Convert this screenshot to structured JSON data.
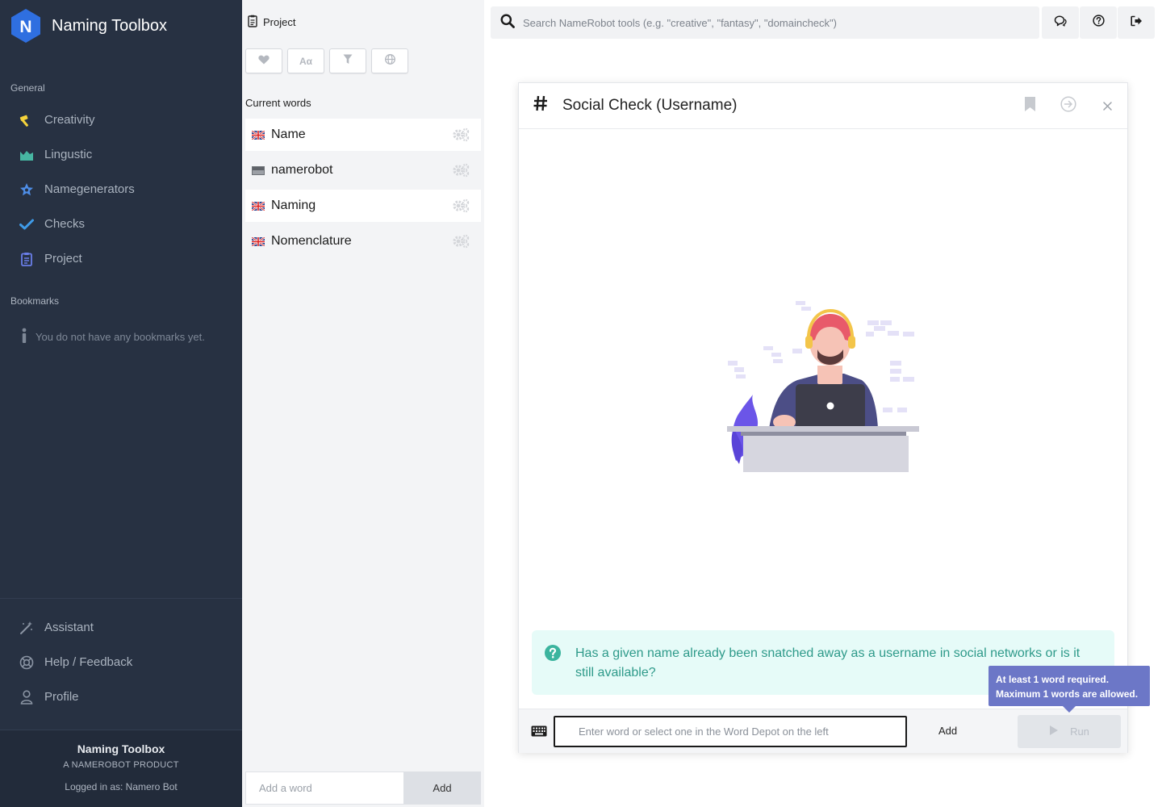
{
  "brand": {
    "title": "Naming Toolbox",
    "logo_letter": "N"
  },
  "sidebar": {
    "general_label": "General",
    "items": [
      {
        "label": "Creativity",
        "icon": "hammer-icon",
        "color": "#f5d33b"
      },
      {
        "label": "Lingustic",
        "icon": "chart-area-icon",
        "color": "#47b6a2"
      },
      {
        "label": "Namegenerators",
        "icon": "star-gear-icon",
        "color": "#4e8ee8"
      },
      {
        "label": "Checks",
        "icon": "check-icon",
        "color": "#3f9be8"
      },
      {
        "label": "Project",
        "icon": "clipboard-icon",
        "color": "#6a7ee8"
      }
    ],
    "bookmarks_label": "Bookmarks",
    "no_bookmarks_text": "You do not have any bookmarks yet.",
    "bottom_items": [
      {
        "label": "Assistant",
        "icon": "magic-wand-icon"
      },
      {
        "label": "Help / Feedback",
        "icon": "lifebuoy-icon"
      },
      {
        "label": "Profile",
        "icon": "user-icon"
      }
    ],
    "footer": {
      "title": "Naming Toolbox",
      "subtitle": "A NAMEROBOT PRODUCT",
      "logged_in": "Logged in as: Namero Bot"
    }
  },
  "depot": {
    "title": "Project",
    "filters": [
      "heart-icon",
      "font-case-icon",
      "filter-icon",
      "globe-icon"
    ],
    "filter_case_label": "Aα",
    "current_words_label": "Current words",
    "words": [
      {
        "text": "Name",
        "flag": "uk-flag",
        "highlighted": true
      },
      {
        "text": "namerobot",
        "flag": "neutral-flag",
        "highlighted": false
      },
      {
        "text": "Naming",
        "flag": "uk-flag",
        "highlighted": true
      },
      {
        "text": "Nomenclature",
        "flag": "uk-flag",
        "highlighted": false
      }
    ],
    "add_word_placeholder": "Add a word",
    "add_button": "Add"
  },
  "topbar": {
    "search_placeholder": "Search NameRobot tools (e.g. \"creative\", \"fantasy\", \"domaincheck\")"
  },
  "tool": {
    "title": "Social Check (Username)",
    "info_text": "Has a given name already been snatched away as a username in social networks or is it still available?",
    "input_placeholder": "Enter word or select one in the Word Depot on the left",
    "add_label": "Add",
    "run_label": "Run"
  },
  "tooltip": {
    "line1": "At least 1 word required.",
    "line2": "Maximum 1 words are allowed."
  },
  "colors": {
    "sidebar_bg": "#273142",
    "brand_hex": "#2f6fe0",
    "info_bg": "#e6fbf8",
    "info_text": "#2e9a8a",
    "tooltip_bg": "#6c77c7"
  }
}
